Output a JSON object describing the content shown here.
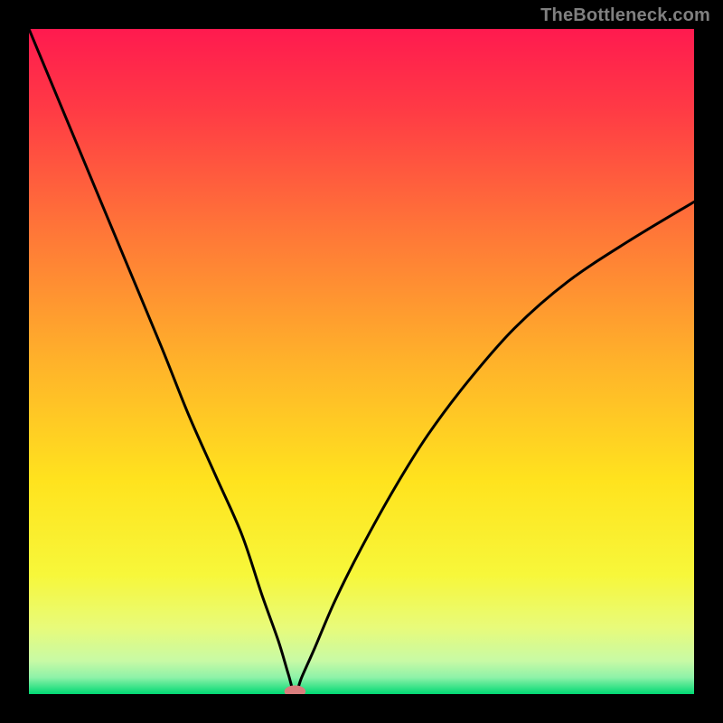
{
  "attribution": "TheBottleneck.com",
  "colors": {
    "frame": "#000000",
    "attribution_text": "#808080",
    "curve": "#000000",
    "marker_fill": "#d97d7d",
    "gradient_stops": [
      {
        "offset": 0.0,
        "color": "#ff1a4f"
      },
      {
        "offset": 0.12,
        "color": "#ff3a45"
      },
      {
        "offset": 0.3,
        "color": "#ff7538"
      },
      {
        "offset": 0.5,
        "color": "#ffb22a"
      },
      {
        "offset": 0.68,
        "color": "#ffe31e"
      },
      {
        "offset": 0.82,
        "color": "#f7f73a"
      },
      {
        "offset": 0.9,
        "color": "#e8fb7a"
      },
      {
        "offset": 0.95,
        "color": "#c8faa5"
      },
      {
        "offset": 0.975,
        "color": "#8ef2a8"
      },
      {
        "offset": 1.0,
        "color": "#00d973"
      }
    ]
  },
  "chart_data": {
    "type": "line",
    "title": "",
    "xlabel": "",
    "ylabel": "",
    "xlim": [
      0,
      100
    ],
    "ylim": [
      0,
      100
    ],
    "legend": false,
    "grid": false,
    "annotations": [],
    "marker": {
      "x": 40,
      "y": 0,
      "rx": 1.6,
      "ry": 0.9
    },
    "series": [
      {
        "name": "bottleneck-curve",
        "x": [
          0,
          5,
          10,
          15,
          20,
          24,
          28,
          32,
          35,
          37.5,
          39,
          40,
          41,
          43,
          46,
          50,
          55,
          60,
          66,
          73,
          81,
          90,
          100
        ],
        "values": [
          100,
          88,
          76,
          64,
          52,
          42,
          33,
          24,
          15,
          8,
          3,
          0,
          2.5,
          7,
          14,
          22,
          31,
          39,
          47,
          55,
          62,
          68,
          74
        ]
      }
    ]
  }
}
